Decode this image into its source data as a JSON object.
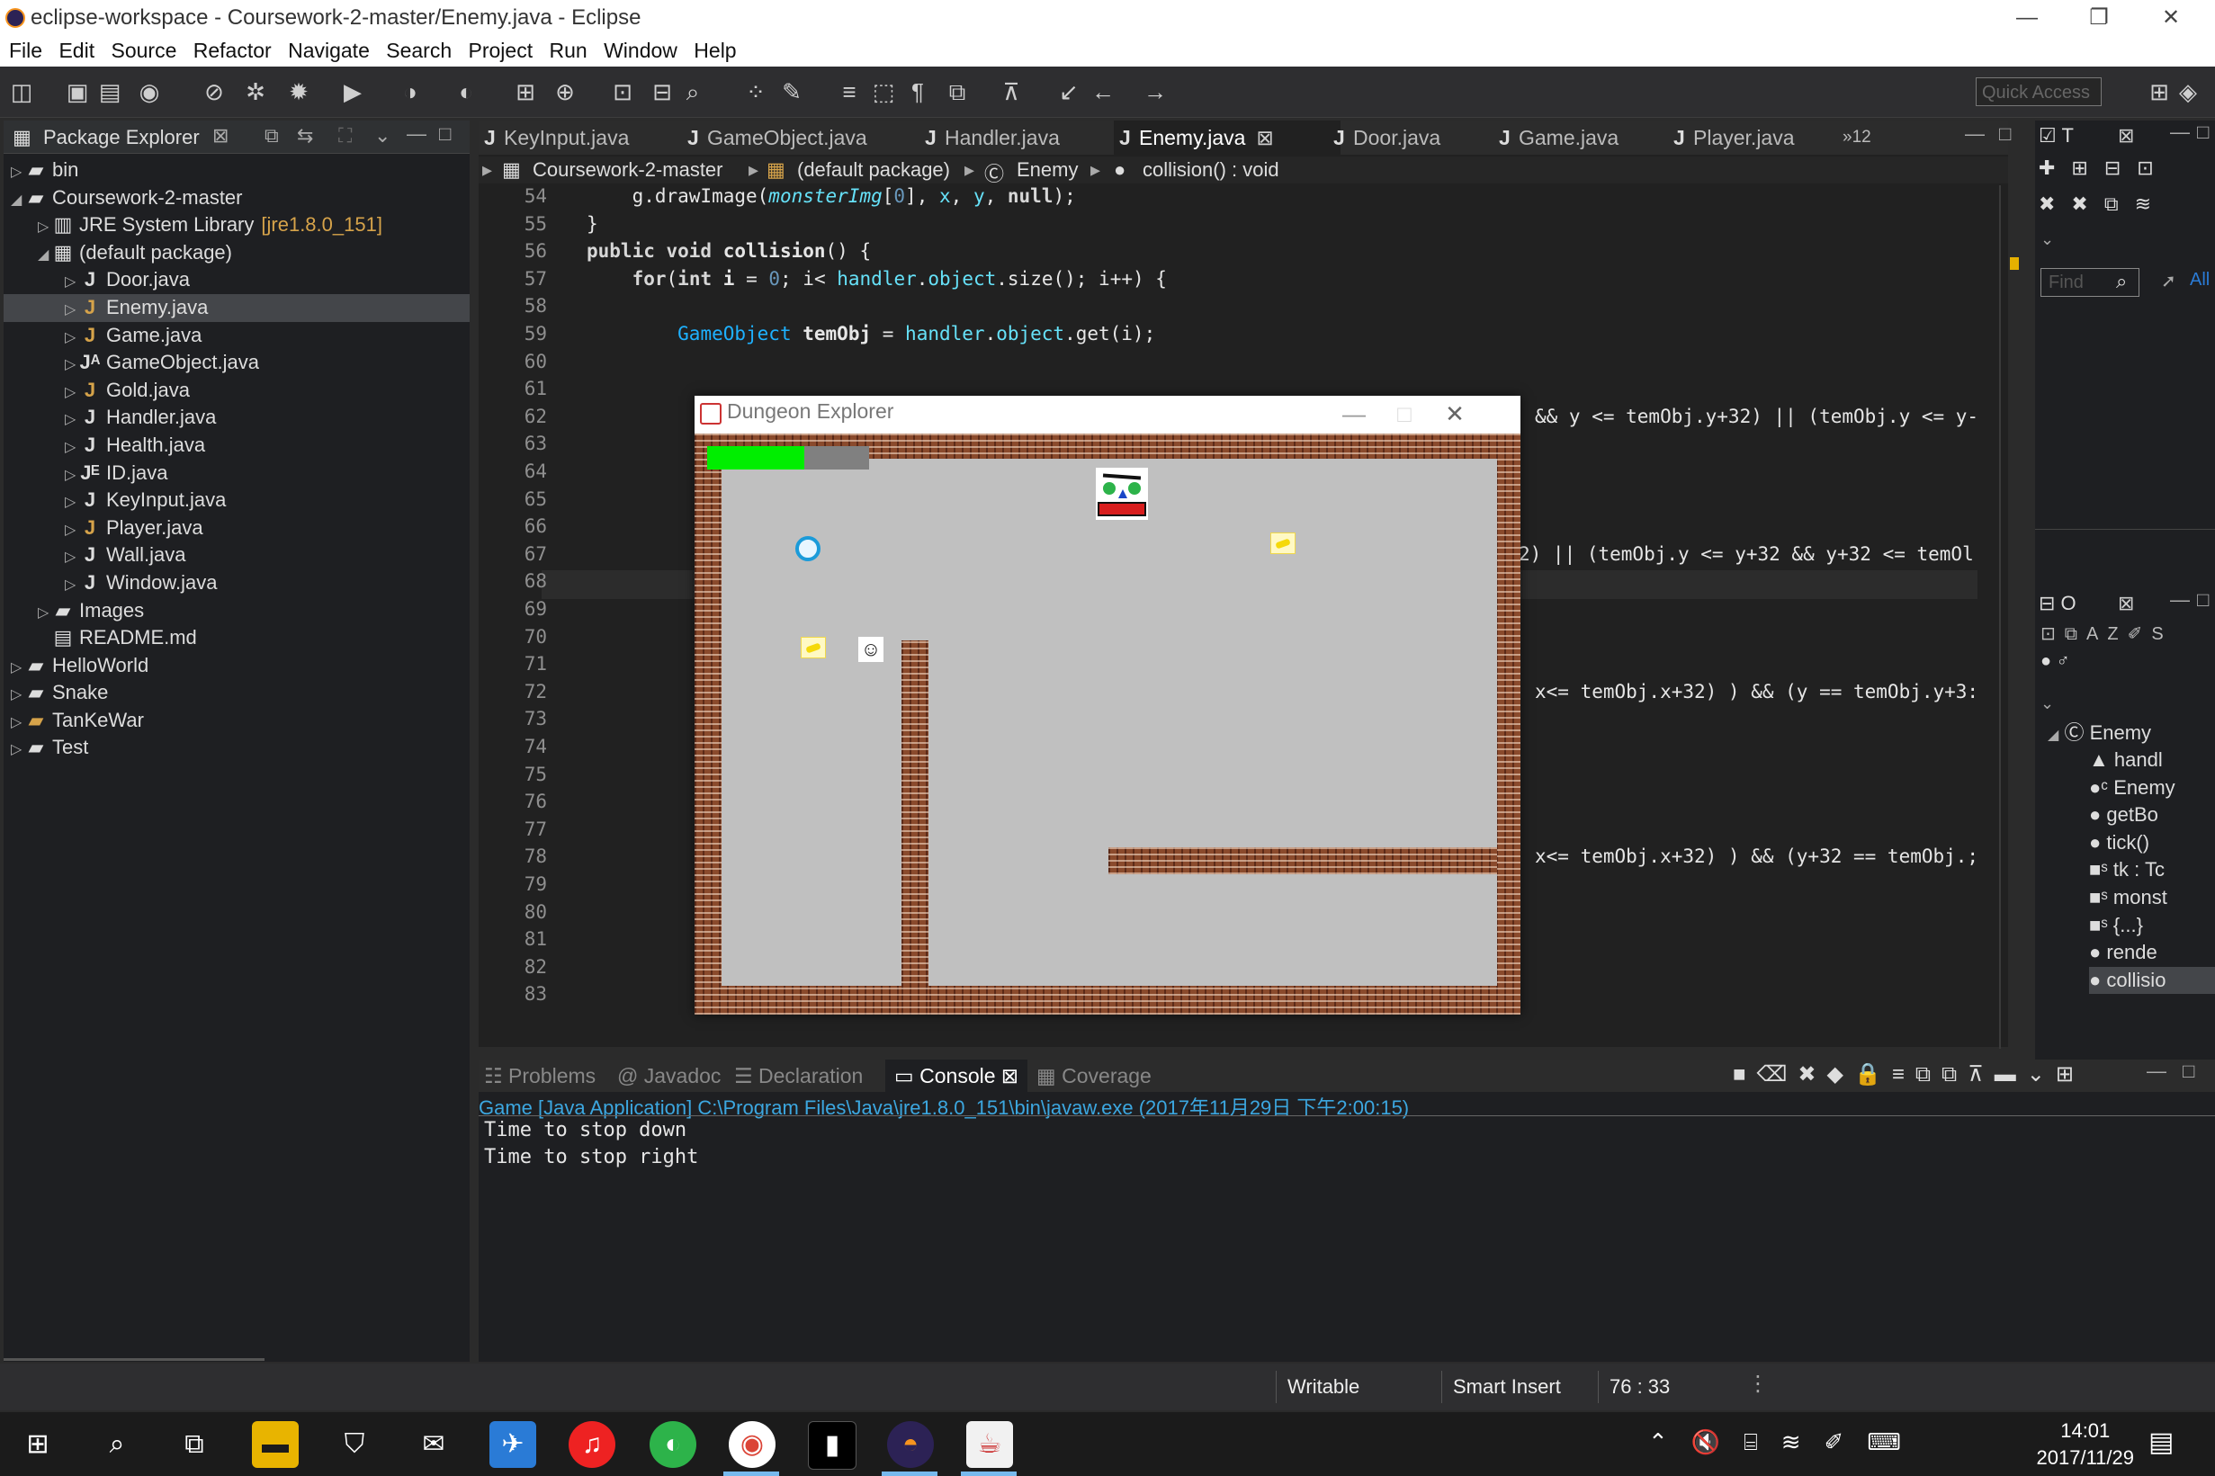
{
  "window": {
    "title": "eclipse-workspace - Coursework-2-master/Enemy.java - Eclipse",
    "minimize": "—",
    "maximize": "❐",
    "close": "✕"
  },
  "menu": [
    "File",
    "Edit",
    "Source",
    "Refactor",
    "Navigate",
    "Search",
    "Project",
    "Run",
    "Window",
    "Help"
  ],
  "toolbar": {
    "quick_access_placeholder": "Quick Access"
  },
  "package_explorer": {
    "title": "Package Explorer",
    "items": [
      {
        "label": "bin",
        "indent": 0,
        "twisty": "▷",
        "icon": "folder"
      },
      {
        "label": "Coursework-2-master",
        "indent": 0,
        "twisty": "◢",
        "icon": "project"
      },
      {
        "label": "JRE System Library",
        "deco": "[jre1.8.0_151]",
        "indent": 1,
        "twisty": "▷",
        "icon": "library"
      },
      {
        "label": "(default package)",
        "indent": 1,
        "twisty": "◢",
        "icon": "package"
      },
      {
        "label": "Door.java",
        "indent": 2,
        "twisty": "▷",
        "icon": "java"
      },
      {
        "label": "Enemy.java",
        "indent": 2,
        "twisty": "▷",
        "icon": "java-warn",
        "selected": true
      },
      {
        "label": "Game.java",
        "indent": 2,
        "twisty": "▷",
        "icon": "java-warn"
      },
      {
        "label": "GameObject.java",
        "indent": 2,
        "twisty": "▷",
        "icon": "java-abstract"
      },
      {
        "label": "Gold.java",
        "indent": 2,
        "twisty": "▷",
        "icon": "java-warn"
      },
      {
        "label": "Handler.java",
        "indent": 2,
        "twisty": "▷",
        "icon": "java"
      },
      {
        "label": "Health.java",
        "indent": 2,
        "twisty": "▷",
        "icon": "java"
      },
      {
        "label": "ID.java",
        "indent": 2,
        "twisty": "▷",
        "icon": "java-enum"
      },
      {
        "label": "KeyInput.java",
        "indent": 2,
        "twisty": "▷",
        "icon": "java"
      },
      {
        "label": "Player.java",
        "indent": 2,
        "twisty": "▷",
        "icon": "java-warn"
      },
      {
        "label": "Wall.java",
        "indent": 2,
        "twisty": "▷",
        "icon": "java"
      },
      {
        "label": "Window.java",
        "indent": 2,
        "twisty": "▷",
        "icon": "java"
      },
      {
        "label": "Images",
        "indent": 1,
        "twisty": "▷",
        "icon": "folder"
      },
      {
        "label": "README.md",
        "indent": 1,
        "twisty": "",
        "icon": "file"
      },
      {
        "label": "HelloWorld",
        "indent": 0,
        "twisty": "▷",
        "icon": "project"
      },
      {
        "label": "Snake",
        "indent": 0,
        "twisty": "▷",
        "icon": "project"
      },
      {
        "label": "TanKeWar",
        "indent": 0,
        "twisty": "▷",
        "icon": "project-warn"
      },
      {
        "label": "Test",
        "indent": 0,
        "twisty": "▷",
        "icon": "project"
      }
    ]
  },
  "editor": {
    "tabs": [
      "KeyInput.java",
      "GameObject.java",
      "Handler.java",
      "Enemy.java",
      "Door.java",
      "Game.java",
      "Player.java"
    ],
    "active_tab": "Enemy.java",
    "overflow": "»12",
    "breadcrumb": [
      "Coursework-2-master",
      "(default package)",
      "Enemy",
      "collision() : void"
    ],
    "line_numbers": [
      "54",
      "55",
      "56",
      "57",
      "58",
      "59",
      "60",
      "61",
      "62",
      "63",
      "64",
      "65",
      "66",
      "67",
      "68",
      "69",
      "70",
      "71",
      "72",
      "73",
      "74",
      "75",
      "76",
      "77",
      "78",
      "79",
      "80",
      "81",
      "82",
      "83"
    ],
    "code_fragments": {
      "l63": "&& y <= temObj.y+32) || (temObj.y <= y-",
      "l68": "2) || (temObj.y <= y+32 && y+32 <= temOl",
      "l73": "x<= temObj.x+32) ) && (y == temObj.y+3:",
      "l79": "x<= temObj.x+32) ) && (y+32 == temObj.;"
    }
  },
  "outline": {
    "find_placeholder": "Find",
    "all": "All",
    "class_name": "Enemy",
    "members": [
      "handl",
      "Enemy",
      "getBo",
      "tick()",
      "tk : Tc",
      "monst",
      "{...}",
      "rende",
      "collisio"
    ]
  },
  "console": {
    "tabs": [
      "Problems",
      "Javadoc",
      "Declaration",
      "Console",
      "Coverage"
    ],
    "active_tab": "Console",
    "launch": "Game [Java Application] C:\\Program Files\\Java\\jre1.8.0_151\\bin\\javaw.exe (2017年11月29日 下午2:00:15)",
    "output": [
      "Time to stop down",
      "Time to stop right"
    ]
  },
  "status": {
    "mode": "Writable",
    "insert": "Smart Insert",
    "position": "76 : 33"
  },
  "game_window": {
    "title": "Dungeon Explorer",
    "health_fraction": 0.6
  },
  "taskbar": {
    "time": "14:01",
    "date": "2017/11/29"
  }
}
